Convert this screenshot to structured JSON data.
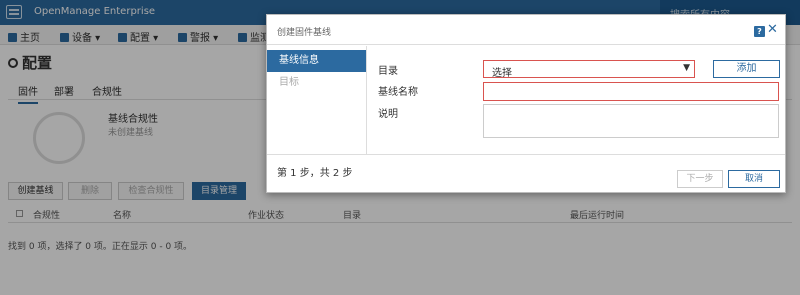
{
  "app": {
    "title": "OpenManage Enterprise",
    "search_label": "搜索所有内容"
  },
  "nav": {
    "items": [
      "主页",
      "设备",
      "配置",
      "警报",
      "监测"
    ]
  },
  "page": {
    "title": "配置",
    "tabs": [
      "固件",
      "部署",
      "合规性"
    ],
    "compliance_title": "基线合规性",
    "compliance_sub": "未创建基线",
    "buttons": {
      "create_baseline": "创建基线",
      "delete": "删除",
      "check_compliance": "检查合规性",
      "catalog_management": "目录管理"
    },
    "table_columns": [
      "合规性",
      "名称",
      "作业状态",
      "目录",
      "最后运行时间"
    ],
    "status_line": "找到 0 项，选择了 0 项。正在显示 0 - 0 项。"
  },
  "dialog": {
    "title": "创建固件基线",
    "help_glyph": "?",
    "close_glyph": "✕",
    "steps": [
      "基线信息",
      "目标"
    ],
    "labels": {
      "catalog": "目录",
      "baseline_name": "基线名称",
      "description": "说明"
    },
    "catalog_select_value": "选择",
    "select_arrow": "▼",
    "add_button": "添加",
    "baseline_name_value": "",
    "description_value": "",
    "step_counter": "第 1 步，共 2 步",
    "next_button": "下一步",
    "cancel_button": "取消"
  },
  "colors": {
    "brand": "#2c6aa0",
    "error_border": "#d9534f"
  }
}
